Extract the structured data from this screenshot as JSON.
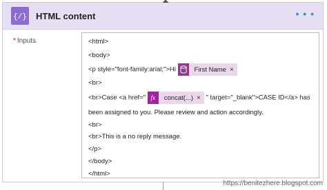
{
  "action": {
    "title": "HTML content",
    "more_label": "• • •",
    "icon": "code-braces-icon"
  },
  "inputs_label": "Inputs",
  "required_marker": "*",
  "content": {
    "l1": "<html>",
    "l2": "<body>",
    "l3_prefix": "<p style=\"font-family:arial;\">Hi",
    "token_first_name": "First Name",
    "l4": "<br>",
    "l5_prefix": "<br>Case <a href=\"",
    "token_concat": "concat(...)",
    "l5_suffix": "\" target=\"_blank\">CASE ID</a> has",
    "l6": "been assigned to you. Please review and action accordingly.",
    "l7": "<br>",
    "l8": "<br>This is a no reply message.",
    "l9": "</p>",
    "l10": "</body>",
    "l11": "</html>",
    "token_close": "×",
    "fx_symbol": "fx"
  },
  "watermark": "https://benitezhere.blogspot.com",
  "colors": {
    "header_bg": "#e7e0f4",
    "icon_purple": "#8c6cd0",
    "token_bg": "#ead7ea",
    "token_icon": "#8e3b8d",
    "more_blue": "#3a8ec9"
  }
}
